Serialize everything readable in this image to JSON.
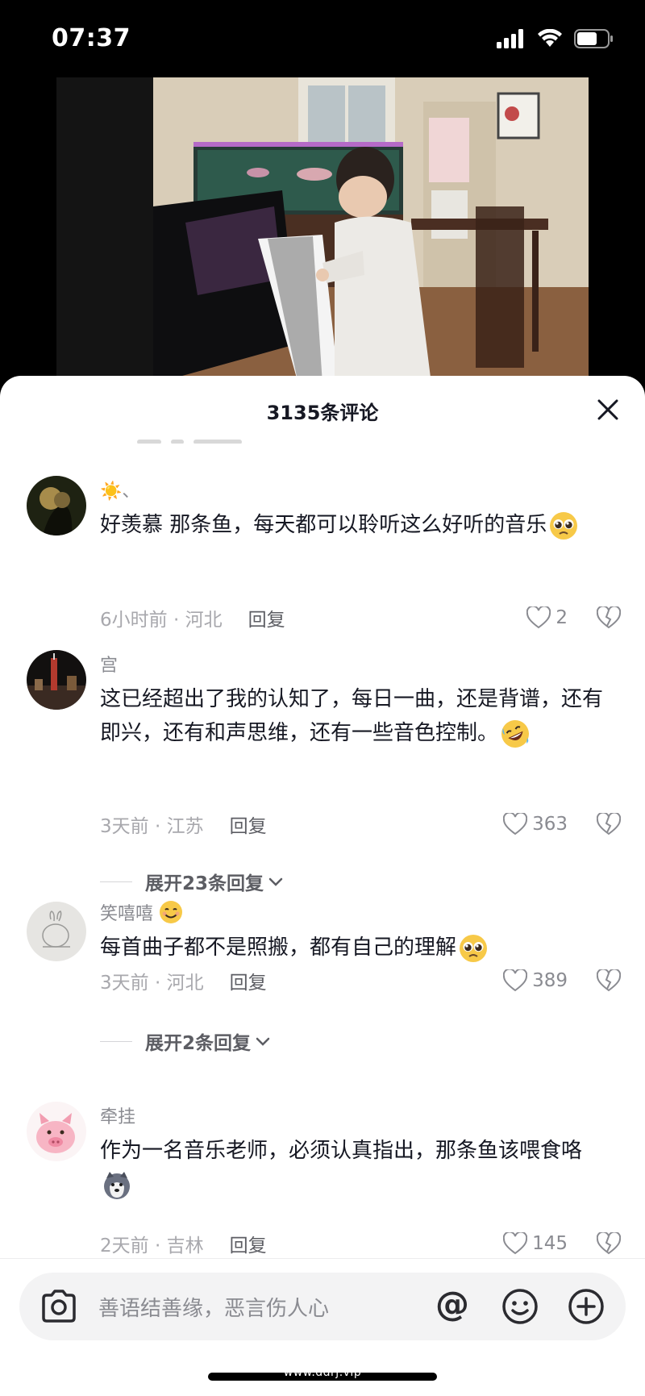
{
  "status_bar": {
    "time": "07:37"
  },
  "header": {
    "title": "3135条评论"
  },
  "comments": [
    {
      "name": "☀️、",
      "text": "好羡慕 那条鱼，每天都可以聆听这么好听的音乐",
      "time_location": "6小时前 · 河北",
      "reply_label": "回复",
      "likes": "2",
      "emoji": "pleading-face"
    },
    {
      "name": "宫",
      "text": "这已经超出了我的认知了，每日一曲，还是背谱，还有即兴，还有和声思维，还有一些音色控制。",
      "time_location": "3天前 · 江苏",
      "reply_label": "回复",
      "likes": "363",
      "emoji": "rofl-face",
      "expand_label": "展开23条回复"
    },
    {
      "name": "笑嘻嘻",
      "text": "每首曲子都不是照搬，都有自己的理解",
      "time_location": "3天前 · 河北",
      "reply_label": "回复",
      "likes": "389",
      "emoji": "pleading-face",
      "expand_label": "展开2条回复"
    },
    {
      "name": "牵挂",
      "text": "作为一名音乐老师，必须认真指出，那条鱼该喂食咯",
      "time_location": "2天前 · 吉林",
      "reply_label": "回复",
      "likes": "145",
      "emoji": "husky-face"
    }
  ],
  "input": {
    "placeholder": "善语结善缘，恶言伤人心",
    "at_symbol": "@"
  },
  "watermark": "www.ddrj.vip",
  "colors": {
    "sheet_bg": "#ffffff",
    "text_primary": "#161823",
    "text_secondary": "#a8a8ad"
  }
}
